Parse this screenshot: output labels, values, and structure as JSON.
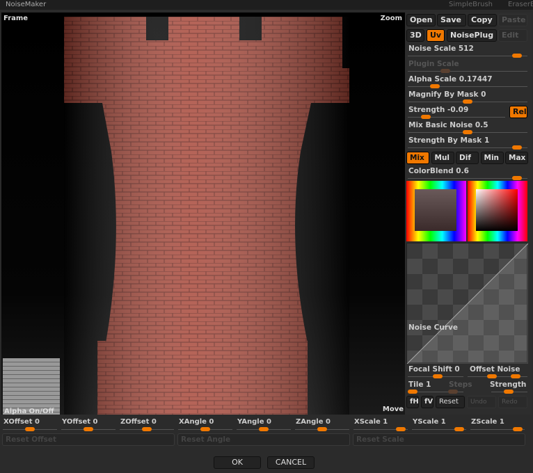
{
  "window": {
    "title": "NoiseMaker",
    "bg_tabs": [
      "SimpleBrush",
      "EraserB"
    ]
  },
  "viewport": {
    "frame_label": "Frame",
    "zoom_label": "Zoom",
    "move_label": "Move",
    "alpha_toggle_label": "Alpha On/Off"
  },
  "panel": {
    "file_buttons": [
      {
        "label": "Open",
        "enabled": true
      },
      {
        "label": "Save",
        "enabled": true
      },
      {
        "label": "Copy",
        "enabled": true
      },
      {
        "label": "Paste",
        "enabled": false
      }
    ],
    "mode_buttons": [
      {
        "label": "3D",
        "active": false
      },
      {
        "label": "Uv",
        "active": true
      },
      {
        "label": "NoisePlug",
        "active": false
      },
      {
        "label": "Edit",
        "enabled": false
      }
    ],
    "sliders": [
      {
        "label": "Noise Scale  512",
        "value_fraction": 0.95,
        "enabled": true
      },
      {
        "label": "Plugin Scale",
        "value_fraction": 0.3,
        "enabled": false
      },
      {
        "label": "Alpha Scale  0.17447",
        "value_fraction": 0.2,
        "enabled": true
      },
      {
        "label": "Magnify By Mask 0",
        "value_fraction": 0.5,
        "enabled": true
      },
      {
        "label": "Strength -0.09",
        "value_fraction": 0.15,
        "enabled": true
      },
      {
        "label": "Mix Basic Noise 0.5",
        "value_fraction": 0.5,
        "enabled": true
      },
      {
        "label": "Strength By Mask 1",
        "value_fraction": 0.95,
        "enabled": true
      }
    ],
    "rel_label": "Rel",
    "blend_modes": [
      {
        "label": "Mix",
        "active": true
      },
      {
        "label": "Mul"
      },
      {
        "label": "Dif"
      },
      {
        "label": "Min"
      },
      {
        "label": "Max"
      }
    ],
    "colorblend": {
      "label": "ColorBlend 0.6",
      "value_fraction": 0.9
    },
    "colors": {
      "accent": "#f07800",
      "color1": "#4a3a3a",
      "color2": "#ff0000"
    },
    "noise_curve_label": "Noise Curve",
    "focal_shift": {
      "label": "Focal Shift 0",
      "value_fraction": 0.5
    },
    "offset_noise": {
      "label": "Offset Noise",
      "value_fraction": 0.5
    },
    "tile": {
      "label": "Tile 1",
      "value_fraction": 0.1
    },
    "steps": {
      "label": "Steps",
      "enabled": false
    },
    "strength2": {
      "label": "Strength",
      "value_fraction": 0.5
    },
    "curve_buttons": [
      {
        "label": "fH"
      },
      {
        "label": "fV"
      },
      {
        "label": "Reset"
      },
      {
        "label": "Undo",
        "enabled": false
      },
      {
        "label": "Redo",
        "enabled": false
      }
    ]
  },
  "bottom": {
    "sliders": [
      {
        "label": "XOffset 0",
        "v": 0.5
      },
      {
        "label": "YOffset 0",
        "v": 0.5
      },
      {
        "label": "ZOffset 0",
        "v": 0.5
      },
      {
        "label": "XAngle 0",
        "v": 0.5
      },
      {
        "label": "YAngle 0",
        "v": 0.5
      },
      {
        "label": "ZAngle 0",
        "v": 0.5
      },
      {
        "label": "XScale 1",
        "v": 0.95
      },
      {
        "label": "YScale 1",
        "v": 0.95
      },
      {
        "label": "ZScale 1",
        "v": 0.95
      }
    ],
    "reset_buttons": [
      "Reset Offset",
      "Reset Angle",
      "Reset Scale"
    ],
    "ok": "OK",
    "cancel": "CANCEL"
  }
}
